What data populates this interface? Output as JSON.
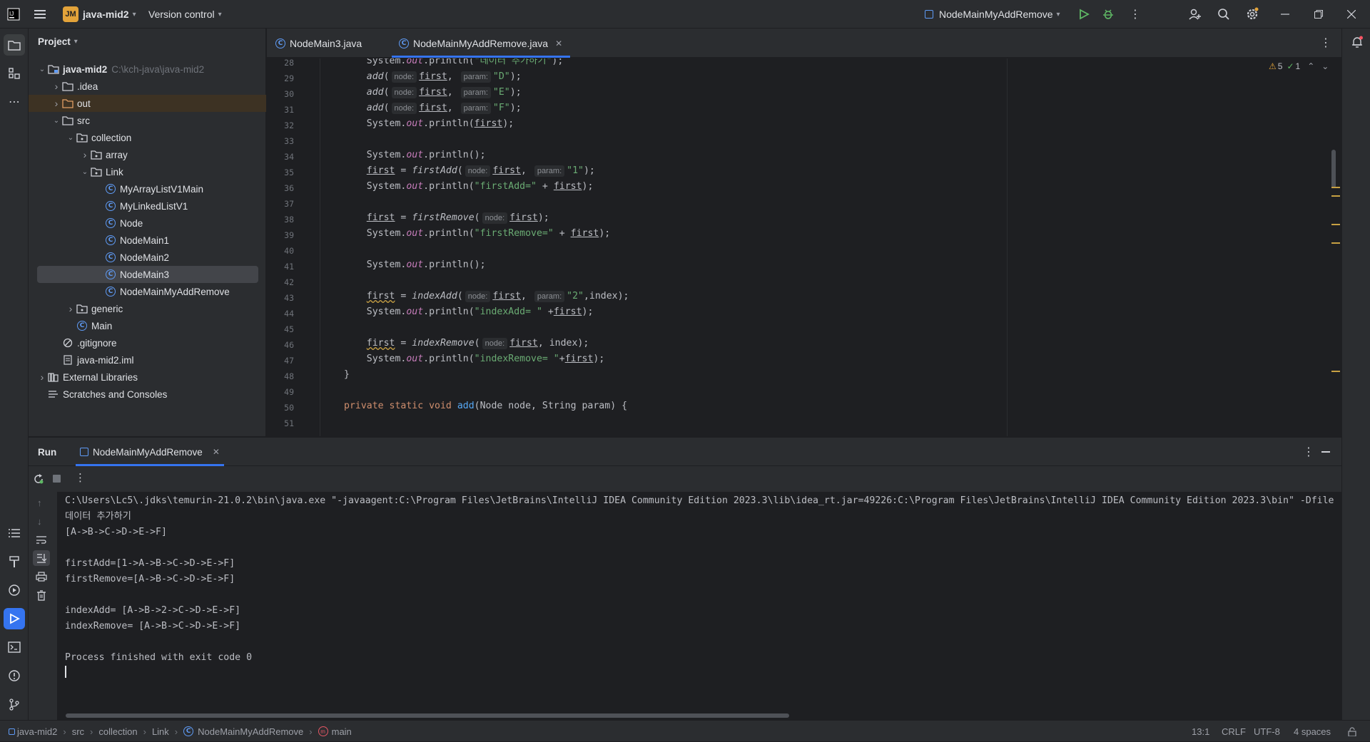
{
  "titlebar": {
    "project_badge": "JM",
    "project_name": "java-mid2",
    "version_control": "Version control",
    "run_config": "NodeMainMyAddRemove"
  },
  "project_panel": {
    "title": "Project",
    "root_name": "java-mid2",
    "root_path": "C:\\kch-java\\java-mid2",
    "items": [
      {
        "label": "java-mid2",
        "depth": 0,
        "kind": "module",
        "expanded": true
      },
      {
        "label": ".idea",
        "depth": 1,
        "kind": "folder",
        "expanded": false
      },
      {
        "label": "out",
        "depth": 1,
        "kind": "folder-out",
        "expanded": false
      },
      {
        "label": "src",
        "depth": 1,
        "kind": "folder",
        "expanded": true
      },
      {
        "label": "collection",
        "depth": 2,
        "kind": "package",
        "expanded": true
      },
      {
        "label": "array",
        "depth": 3,
        "kind": "package",
        "expanded": false
      },
      {
        "label": "Link",
        "depth": 3,
        "kind": "package",
        "expanded": true
      },
      {
        "label": "MyArrayListV1Main",
        "depth": 4,
        "kind": "class"
      },
      {
        "label": "MyLinkedListV1",
        "depth": 4,
        "kind": "class"
      },
      {
        "label": "Node",
        "depth": 4,
        "kind": "class"
      },
      {
        "label": "NodeMain1",
        "depth": 4,
        "kind": "class"
      },
      {
        "label": "NodeMain2",
        "depth": 4,
        "kind": "class"
      },
      {
        "label": "NodeMain3",
        "depth": 4,
        "kind": "class",
        "selected": true
      },
      {
        "label": "NodeMainMyAddRemove",
        "depth": 4,
        "kind": "class"
      },
      {
        "label": "generic",
        "depth": 2,
        "kind": "package",
        "expanded": false
      },
      {
        "label": "Main",
        "depth": 2,
        "kind": "class"
      },
      {
        "label": ".gitignore",
        "depth": 1,
        "kind": "ignore"
      },
      {
        "label": "java-mid2.iml",
        "depth": 1,
        "kind": "file"
      },
      {
        "label": "External Libraries",
        "depth": 0,
        "kind": "library",
        "expanded": false
      },
      {
        "label": "Scratches and Consoles",
        "depth": 0,
        "kind": "scratch"
      }
    ]
  },
  "editor": {
    "tabs": [
      {
        "label": "NodeMain3.java",
        "active": false
      },
      {
        "label": "NodeMainMyAddRemove.java",
        "active": true
      }
    ],
    "warnings": "5",
    "checks": "1",
    "line_numbers": [
      "28",
      "29",
      "30",
      "31",
      "32",
      "33",
      "34",
      "35",
      "36",
      "37",
      "38",
      "39",
      "40",
      "41",
      "42",
      "43",
      "44",
      "45",
      "46",
      "47",
      "48",
      "49",
      "50",
      "51"
    ]
  },
  "run_panel": {
    "title": "Run",
    "tab_label": "NodeMainMyAddRemove",
    "console_lines": [
      "C:\\Users\\Lc5\\.jdks\\temurin-21.0.2\\bin\\java.exe \"-javaagent:C:\\Program Files\\JetBrains\\IntelliJ IDEA Community Edition 2023.3\\lib\\idea_rt.jar=49226:C:\\Program Files\\JetBrains\\IntelliJ IDEA Community Edition 2023.3\\bin\" -Dfile",
      "데이터 추가하기",
      "[A->B->C->D->E->F]",
      "",
      "firstAdd=[1->A->B->C->D->E->F]",
      "firstRemove=[A->B->C->D->E->F]",
      "",
      "indexAdd= [A->B->2->C->D->E->F]",
      "indexRemove= [A->B->C->D->E->F]",
      "",
      "Process finished with exit code 0"
    ]
  },
  "statusbar": {
    "breadcrumbs": [
      "java-mid2",
      "src",
      "collection",
      "Link",
      "NodeMainMyAddRemove",
      "main"
    ],
    "position": "13:1",
    "line_sep": "CRLF",
    "encoding": "UTF-8",
    "indent": "4 spaces"
  }
}
